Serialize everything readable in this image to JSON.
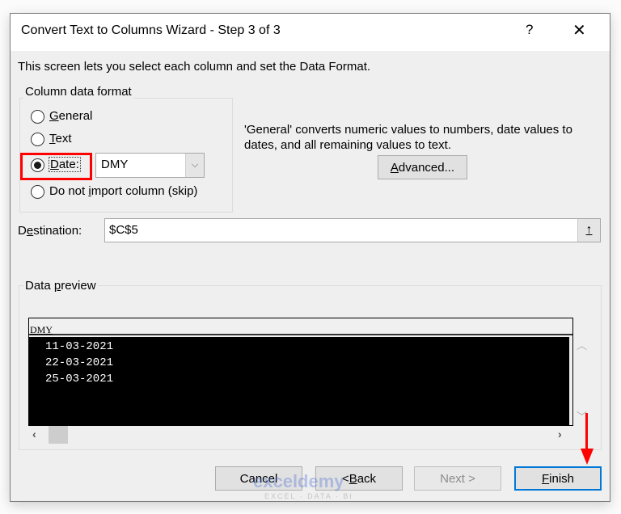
{
  "window": {
    "title": "Convert Text to Columns Wizard - Step 3 of 3",
    "help_label": "?",
    "close_label": "✕"
  },
  "instructions": "This screen lets you select each column and set the Data Format.",
  "column_format": {
    "legend": "Column data format",
    "options": [
      {
        "label": "General",
        "mnemonic": "G",
        "rest": "eneral",
        "checked": false
      },
      {
        "label": "Text",
        "mnemonic": "T",
        "rest": "ext",
        "checked": false
      },
      {
        "label": "Date:",
        "mnemonic": "D",
        "rest": "ate:",
        "checked": true
      },
      {
        "label": "Do not import column (skip)",
        "pre": "Do not ",
        "mnemonic": "i",
        "rest": "mport column (skip)",
        "checked": false
      }
    ],
    "date_format": {
      "value": "DMY"
    }
  },
  "general_note": "'General' converts numeric values to numbers, date values to dates, and all remaining values to text.",
  "advanced_button": {
    "label": "Advanced...",
    "mnemonic": "A",
    "rest": "dvanced..."
  },
  "destination": {
    "label_pre": "D",
    "mnemonic": "e",
    "label_rest": "stination:",
    "value": "$C$5",
    "collapse_icon": "↑"
  },
  "preview": {
    "legend_pre": "Data ",
    "mnemonic": "p",
    "legend_rest": "review",
    "column_header": "DMY",
    "rows": [
      "11-03-2021",
      "22-03-2021",
      "25-03-2021"
    ]
  },
  "buttons": {
    "cancel": "Cancel",
    "back_pre": "< ",
    "back_mnemonic": "B",
    "back_rest": "ack",
    "next": "Next >",
    "finish_mnemonic": "F",
    "finish_rest": "inish"
  },
  "annotation": {
    "highlight_color": "#ff0000"
  },
  "watermark": {
    "brand": "exceldemy",
    "tagline": "EXCEL · DATA · BI"
  }
}
